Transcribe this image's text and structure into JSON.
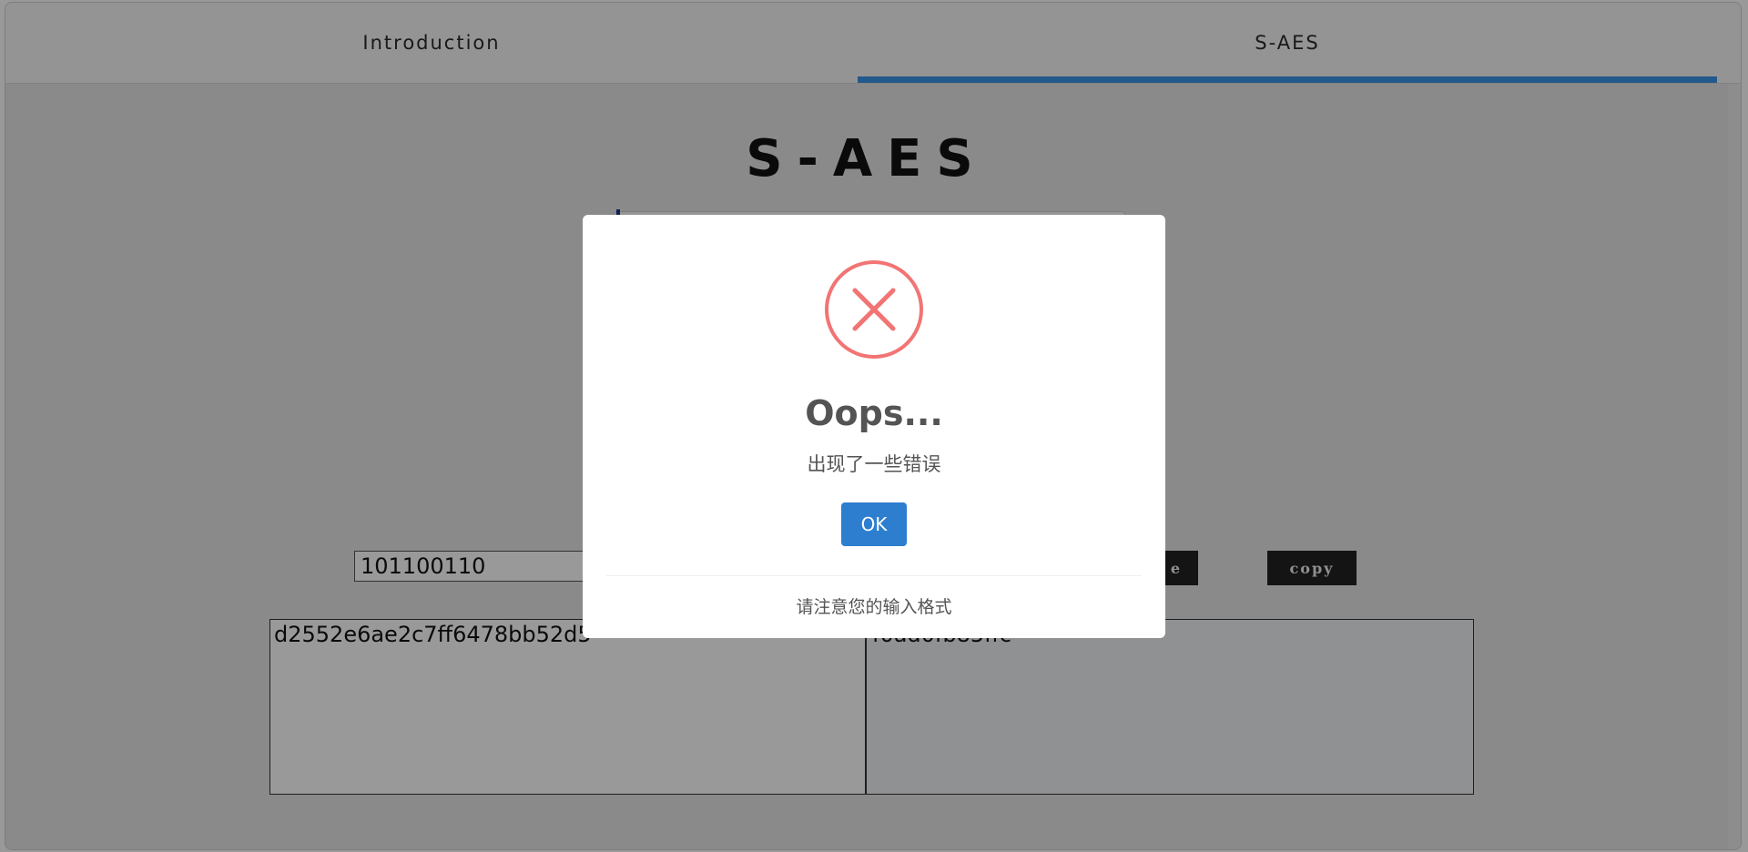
{
  "tabs": [
    {
      "label": "Introduction",
      "active": false
    },
    {
      "label": "S-AES",
      "active": true
    }
  ],
  "colors": {
    "tab_underline": "#3a93e8",
    "ok_button": "#2d7ecf",
    "error_icon": "#f27474",
    "dark_button": "#222222"
  },
  "main": {
    "title": "S-AES",
    "key_input_value": "101100110",
    "decrypt_button_label": "e",
    "copy_button_label": "copy",
    "input_text": "d2552e6ae2c7ff6478bb52d5",
    "output_text": "f0ad0fb85ffc"
  },
  "dialog": {
    "icon": "error-x-icon",
    "title": "Oops...",
    "text": "出现了一些错误",
    "ok_label": "OK",
    "footer": "请注意您的输入格式"
  }
}
